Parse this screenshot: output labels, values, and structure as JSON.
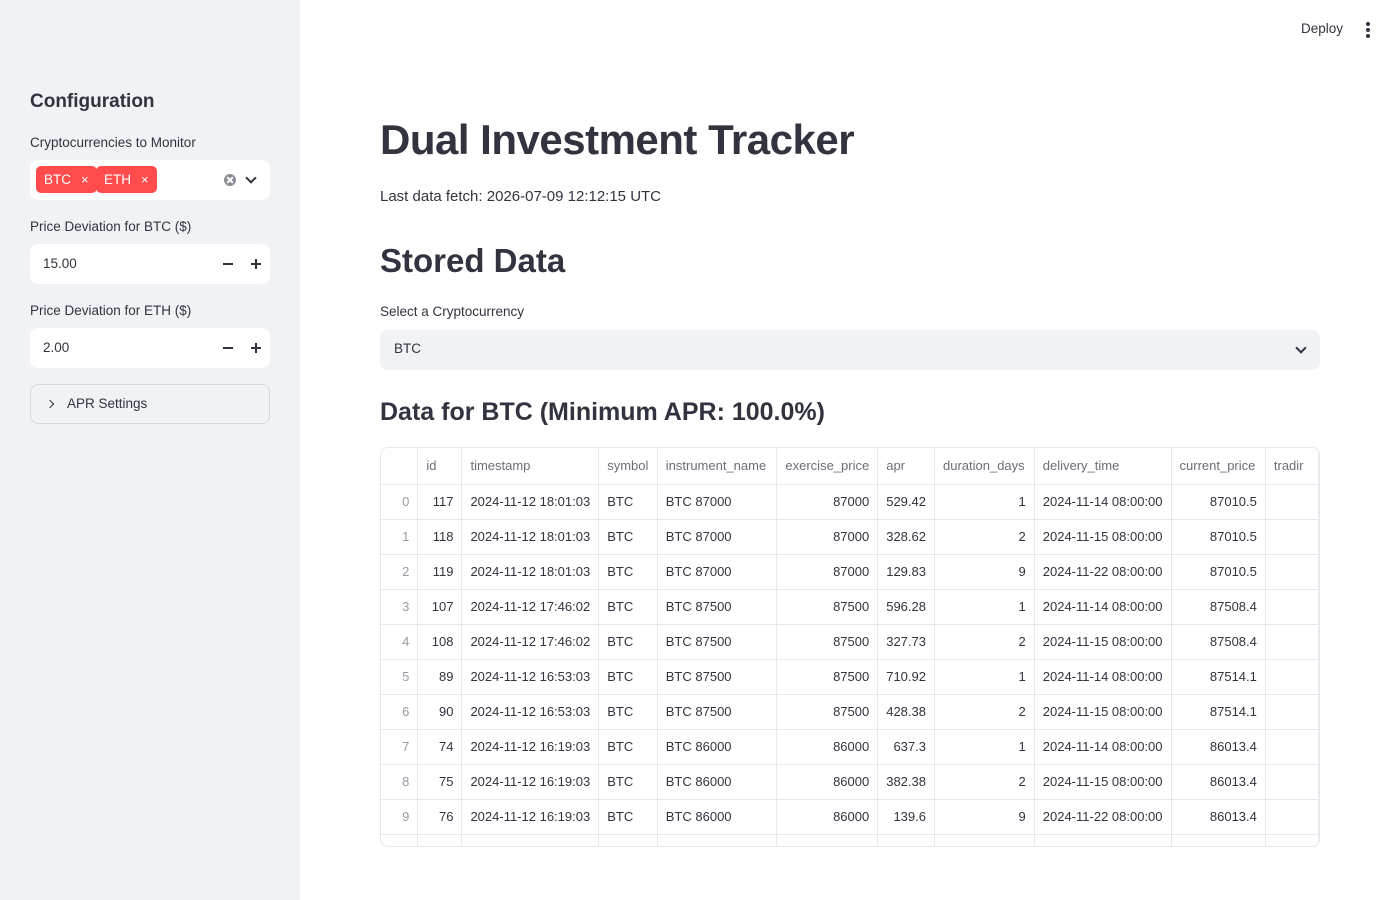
{
  "sidebar": {
    "title": "Configuration",
    "crypto_label": "Cryptocurrencies to Monitor",
    "chips": [
      {
        "label": "BTC",
        "remove": "×"
      },
      {
        "label": "ETH",
        "remove": "×"
      }
    ],
    "btc_deviation_label": "Price Deviation for BTC ($)",
    "btc_deviation_value": "15.00",
    "eth_deviation_label": "Price Deviation for ETH ($)",
    "eth_deviation_value": "2.00",
    "apr_expander_label": "APR Settings"
  },
  "header": {
    "deploy_label": "Deploy"
  },
  "main": {
    "title": "Dual Investment Tracker",
    "last_fetch": "Last data fetch: 2026-07-09 12:12:15 UTC",
    "section_title": "Stored Data",
    "select_label": "Select a Cryptocurrency",
    "select_value": "BTC",
    "data_title": "Data for BTC (Minimum APR: 100.0%)"
  },
  "table": {
    "columns": [
      "",
      "id",
      "timestamp",
      "symbol",
      "instrument_name",
      "exercise_price",
      "apr",
      "duration_days",
      "delivery_time",
      "current_price",
      "tradir"
    ],
    "rows": [
      [
        "0",
        "117",
        "2024-11-12 18:01:03",
        "BTC",
        "BTC 87000",
        "87000",
        "529.42",
        "1",
        "2024-11-14 08:00:00",
        "87010.5",
        ""
      ],
      [
        "1",
        "118",
        "2024-11-12 18:01:03",
        "BTC",
        "BTC 87000",
        "87000",
        "328.62",
        "2",
        "2024-11-15 08:00:00",
        "87010.5",
        ""
      ],
      [
        "2",
        "119",
        "2024-11-12 18:01:03",
        "BTC",
        "BTC 87000",
        "87000",
        "129.83",
        "9",
        "2024-11-22 08:00:00",
        "87010.5",
        ""
      ],
      [
        "3",
        "107",
        "2024-11-12 17:46:02",
        "BTC",
        "BTC 87500",
        "87500",
        "596.28",
        "1",
        "2024-11-14 08:00:00",
        "87508.4",
        ""
      ],
      [
        "4",
        "108",
        "2024-11-12 17:46:02",
        "BTC",
        "BTC 87500",
        "87500",
        "327.73",
        "2",
        "2024-11-15 08:00:00",
        "87508.4",
        ""
      ],
      [
        "5",
        "89",
        "2024-11-12 16:53:03",
        "BTC",
        "BTC 87500",
        "87500",
        "710.92",
        "1",
        "2024-11-14 08:00:00",
        "87514.1",
        ""
      ],
      [
        "6",
        "90",
        "2024-11-12 16:53:03",
        "BTC",
        "BTC 87500",
        "87500",
        "428.38",
        "2",
        "2024-11-15 08:00:00",
        "87514.1",
        ""
      ],
      [
        "7",
        "74",
        "2024-11-12 16:19:03",
        "BTC",
        "BTC 86000",
        "86000",
        "637.3",
        "1",
        "2024-11-14 08:00:00",
        "86013.4",
        ""
      ],
      [
        "8",
        "75",
        "2024-11-12 16:19:03",
        "BTC",
        "BTC 86000",
        "86000",
        "382.38",
        "2",
        "2024-11-15 08:00:00",
        "86013.4",
        ""
      ],
      [
        "9",
        "76",
        "2024-11-12 16:19:03",
        "BTC",
        "BTC 86000",
        "86000",
        "139.6",
        "9",
        "2024-11-22 08:00:00",
        "86013.4",
        ""
      ]
    ]
  },
  "colors": {
    "accent": "#ff4b4b",
    "sidebar_bg": "#f0f2f6",
    "text": "#31333f"
  }
}
